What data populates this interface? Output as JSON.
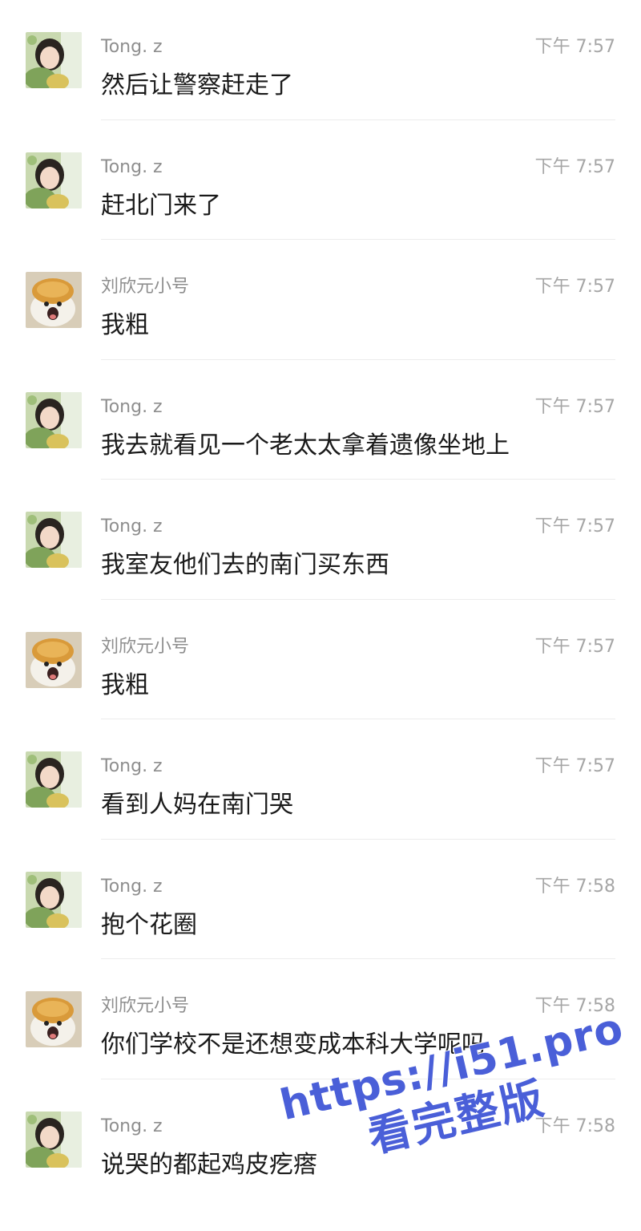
{
  "users": {
    "tong": {
      "name": "Tong. z",
      "avatar_icon": "girl-photo-avatar"
    },
    "liu": {
      "name": "刘欣元小号",
      "avatar_icon": "dog-with-bread-avatar"
    }
  },
  "messages": [
    {
      "name": "Tong. z",
      "time": "下午 7:57",
      "text": "然后让警察赶走了"
    },
    {
      "name": "Tong. z",
      "time": "下午 7:57",
      "text": "赶北门来了"
    },
    {
      "name": "刘欣元小号",
      "time": "下午 7:57",
      "text": "我粗"
    },
    {
      "name": "Tong. z",
      "time": "下午 7:57",
      "text": "我去就看见一个老太太拿着遗像坐地上"
    },
    {
      "name": "Tong. z",
      "time": "下午 7:57",
      "text": "我室友他们去的南门买东西"
    },
    {
      "name": "刘欣元小号",
      "time": "下午 7:57",
      "text": "我粗"
    },
    {
      "name": "Tong. z",
      "time": "下午 7:57",
      "text": "看到人妈在南门哭"
    },
    {
      "name": "Tong. z",
      "time": "下午 7:58",
      "text": "抱个花圈"
    },
    {
      "name": "刘欣元小号",
      "time": "下午 7:58",
      "text": "你们学校不是还想变成本科大学呢吗"
    },
    {
      "name": "Tong. z",
      "time": "下午 7:58",
      "text": "说哭的都起鸡皮疙瘩"
    }
  ],
  "watermark": {
    "url": "https://i51.pro",
    "text": "看完整版"
  },
  "colors": {
    "name": "#8e8e8e",
    "time": "#a6a6a6",
    "text": "#1a1a1a",
    "divider": "#ececec",
    "watermark": "#4a5fd8"
  }
}
